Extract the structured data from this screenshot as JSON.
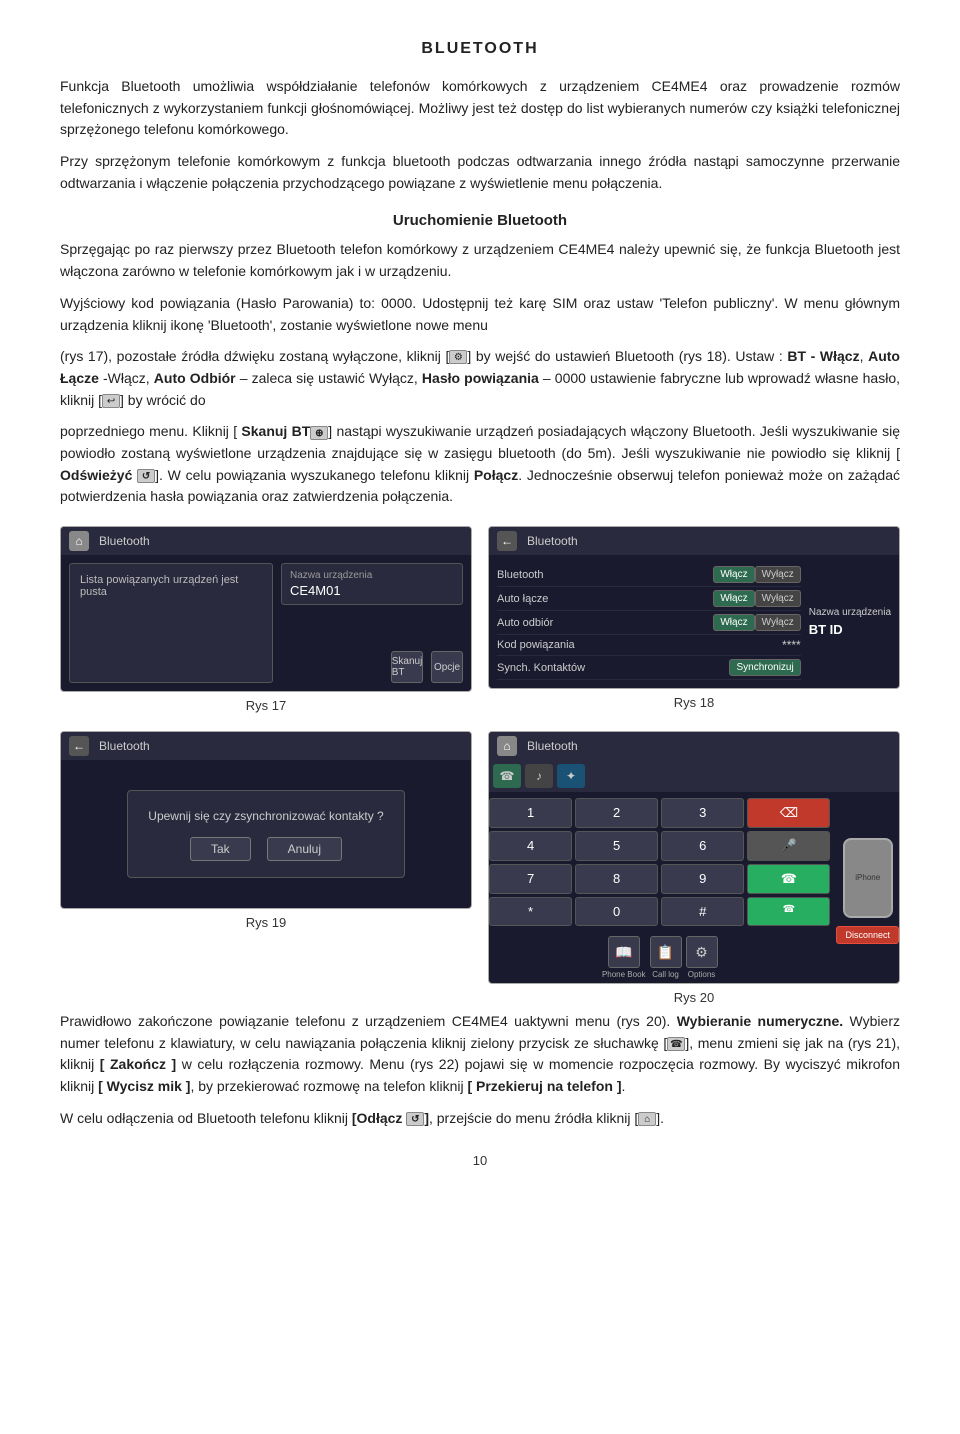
{
  "page": {
    "title": "BLUETOOTH",
    "page_number": "10"
  },
  "paragraphs": {
    "p1": "Funkcja  Bluetooth  umożliwia  współdziałanie  telefonów  komórkowych  z  urządzeniem  CE4ME4 oraz  prowadzenie  rozmów  telefonicznych  z  wykorzystaniem  funkcji  głośnomówiącej.",
    "p2": "Możliwy  jest  też  dostęp  do  list  wybieranych  numerów   czy   książki  telefonicznej  sprzężonego  telefonu  komórkowego.",
    "p3": "Przy  sprzężonym  telefonie  komórkowym  z  funkcja  bluetooth  podczas  odtwarzania  innego  źródła nastąpi  samoczynne  przerwanie  odtwarzania  i  włączenie  połączenia  przychodzącego   powiązane  z  wyświetlenie  menu  połączenia.",
    "section_title": "Uruchomienie  Bluetooth",
    "p4": "Sprzęgając  po  raz  pierwszy  przez  Bluetooth  telefon  komórkowy  z  urządzeniem  CE4ME4  należy  upewnić  się,  że  funkcja  Bluetooth  jest  włączona  zarówno  w  telefonie  komórkowym  jak  i  w  urządzeniu.",
    "p5": "Wyjściowy  kod  powiązania  (Hasło  Parowania)  to:  0000.  Udostępnij  też  karę  SIM  oraz  ustaw  'Telefon  publiczny'.  W  menu  głównym  urządzenia   kliknij  ikonę  'Bluetooth',  zostanie  wyświetlone  nowe  menu",
    "p6": "(rys  17),  pozostałe  źródła  dźwięku  zostaną  wyłączone,  kliknij  [  ⚙  ]  by  wejść  do  ustawień  Bluetooth  (rys  18).  Ustaw  :   BT  -  Włącz,   Auto Łącze  -Włącz,   Auto Odbiór  –  zaleca  się  ustawić  Wyłącz ,  Hasło powiązania  –  0000  ustawienie  fabryczne  lub  wprowadź  własne  hasło,  kliknij   [  ↩  ]  by  wrócić  do",
    "p7": "poprzedniego  menu.  Kliknij  [ Skanuj BT ⊕  ]  nastąpi  wyszukiwanie  urządzeń  posiadających  włączony  Bluetooth.  Jeśli  wyszukiwanie  się   powiodło  zostaną  wyświetlone  urządzenia  znajdujące  się  w  zasięgu  bluetooth  (do  5m).  Jeśli  wyszukiwanie  nie  powiodło  się  kliknij  [ Odświeżyć  ↺  ].  W  celu  powiązania  wyszukanego  telefonu  kliknij  Połącz.  Jednocześnie  obserwuj  telefon  ponieważ  może  on  zażądać  potwierdzenia  hasła  powiązania  oraz  zatwierdzenia   połączenia.",
    "p8": "Prawidłowo  zakończone  powiązanie  telefonu  z  urządzeniem  CE4ME4  uaktywni  menu  (rys  20).  Wybieranie  numeryczne.   Wybierz  numer  telefonu  z  klawiatury,  w  celu  nawiązania  połączenia  kliknij  zielony  przycisk  ze  słuchawkę  [  ☎  ],  menu  zmieni  się  jak  na  (rys  21),   kliknij  [ Zakończ ]  w  celu  rozłączenia  rozmowy.   Menu  (rys  22)  pojawi  się  w  momencie  rozpoczęcia  rozmowy.   By  wyciszyć  mikrofon  kliknij  [ Wycisz mik ],  by  przekierować  rozmowę  na  telefon  kliknij  [ Przekieruj na telefon ].",
    "p9": "W  celu  odłączenia  od  Bluetooth  telefonu  kliknij  [Odłącz  ↺],  przejście  do  menu  źródła  kliknij  [  ⌂  ]."
  },
  "rys17": {
    "label": "Rys 17",
    "top_bar": {
      "home_icon": "⌂",
      "title": "Bluetooth"
    },
    "left_panel": {
      "text": "Lista powiązanych urządzeń jest pusta"
    },
    "right_panel": {
      "device_name_label": "Nazwa urządzenia",
      "device_name_value": "CE4M01"
    },
    "bottom_btns": {
      "scan_label": "Skanuj BT",
      "options_label": "Opcje"
    }
  },
  "rys18": {
    "label": "Rys 18",
    "top_bar": {
      "back_icon": "←",
      "title": "Bluetooth"
    },
    "rows": [
      {
        "label": "Bluetooth",
        "btn1": "Włącz",
        "btn2": "Wyłącz"
      },
      {
        "label": "Auto łącze",
        "btn1": "Włącz",
        "btn2": "Wyłącz"
      },
      {
        "label": "Auto odbiór",
        "btn1": "Włącz",
        "btn2": "Wyłącz"
      },
      {
        "label": "Kod powiązania",
        "value": "****"
      },
      {
        "label": "Synch. Kontaktów",
        "btn1": "Synchronizuj"
      }
    ],
    "right_panel": {
      "label": "Nazwa urządzenia",
      "value": "BT ID"
    }
  },
  "rys19": {
    "label": "Rys 19",
    "top_bar": {
      "back_icon": "←",
      "title": "Bluetooth"
    },
    "dialog": {
      "text": "Upewnij się czy zsynchronizować kontakty ?",
      "btn_ok": "Tak",
      "btn_cancel": "Anuluj"
    }
  },
  "rys20": {
    "label": "Rys 20",
    "top_bar": {
      "home_icon": "⌂",
      "title": "Bluetooth"
    },
    "tabs": [
      "☎",
      "♪",
      "✦"
    ],
    "keypad": [
      [
        "1",
        "2",
        "3",
        "⌫"
      ],
      [
        "4",
        "5",
        "6",
        "🎤"
      ],
      [
        "7",
        "8",
        "9",
        "☎"
      ],
      [
        "*",
        "0",
        "#",
        "☎"
      ]
    ],
    "right": {
      "device": "iPhone",
      "disconnect": "Disconnect"
    },
    "bottom_icons": [
      "📖",
      "📋",
      "⚙"
    ],
    "bottom_labels": [
      "Phone Book",
      "Call log",
      "Options"
    ]
  }
}
